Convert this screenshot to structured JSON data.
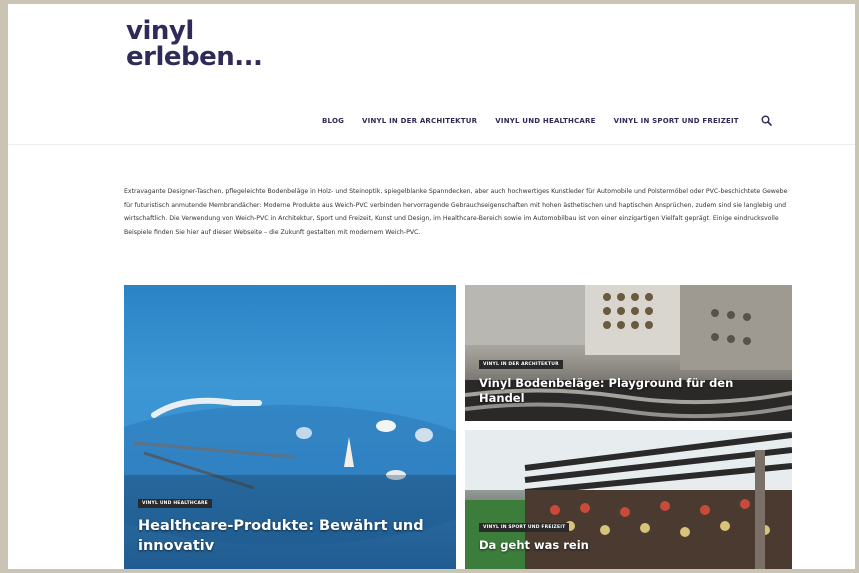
{
  "logo": {
    "line1": "vinyl",
    "line2": "erleben..."
  },
  "nav": {
    "items": [
      {
        "label": "BLOG"
      },
      {
        "label": "VINYL IN DER ARCHITEKTUR"
      },
      {
        "label": "VINYL UND HEALTHCARE"
      },
      {
        "label": "VINYL IN SPORT UND FREIZEIT"
      }
    ]
  },
  "intro": "Extravagante Designer-Taschen, pflegeleichte Bodenbeläge in Holz- und Steinoptik, spiegelblanke Spanndecken, aber auch hochwertiges Kunstleder für Automobile und Polstermöbel oder PVC-beschichtete Gewebe für futuristisch anmutende Membrandächer: Moderne Produkte aus Weich-PVC verbinden hervorragende Gebrauchseigenschaften mit hohen ästhetischen und haptischen Ansprüchen, zudem sind sie langlebig und wirtschaftlich. Die Verwendung von Weich-PVC in Architektur, Sport und Freizeit, Kunst und Design, im Healthcare-Bereich sowie im Automobilbau ist von einer einzigartigen Vielfalt geprägt. Einige eindrucksvolle Beispiele finden Sie hier auf dieser Webseite – die Zukunft gestalten mit modernem Weich-PVC.",
  "tiles": [
    {
      "badge": "VINYL UND HEALTHCARE",
      "title": "Healthcare-Produkte: Bewährt und innovativ"
    },
    {
      "badge": "VINYL IN DER ARCHITEKTUR",
      "title": "Vinyl Bodenbeläge: Playground für den Handel"
    },
    {
      "badge": "VINYL IN SPORT UND FREIZEIT",
      "title": "Da geht was rein"
    }
  ],
  "icons": {
    "search": "search-icon"
  }
}
